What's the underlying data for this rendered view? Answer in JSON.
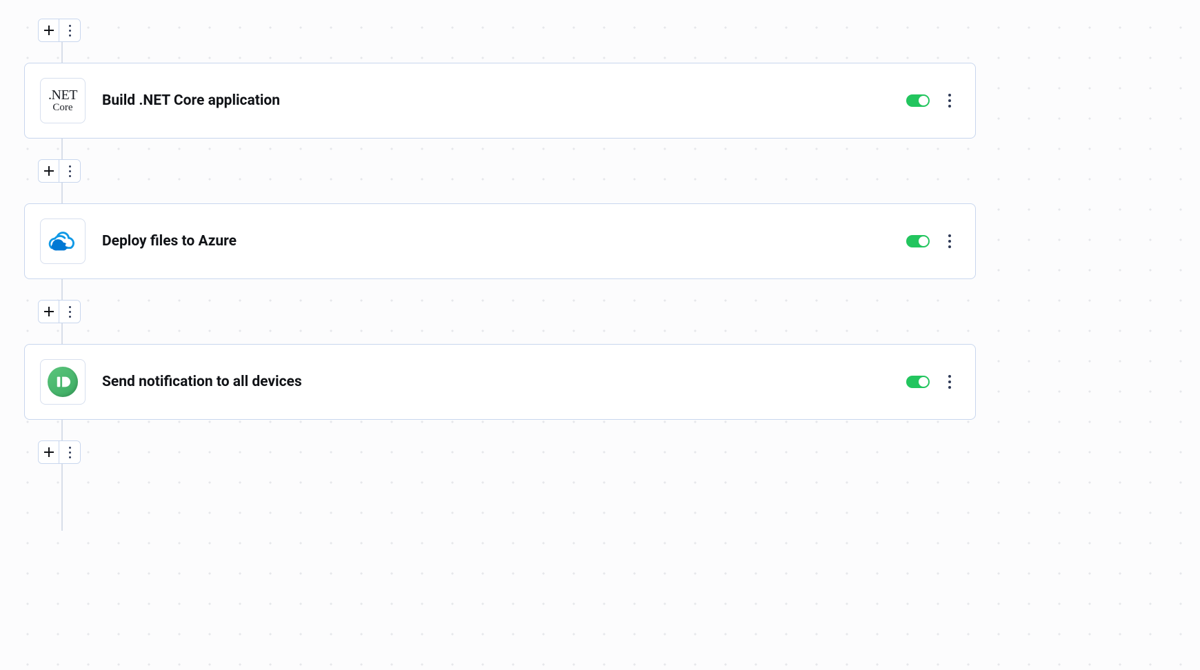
{
  "icons": {
    "dotnet": {
      "line1": ".NET",
      "line2": "Core"
    }
  },
  "colors": {
    "toggle_on": "#22c55e",
    "node_border": "#c8d6ee",
    "azure_blue_dark": "#0078d4",
    "azure_blue_mid": "#1099e6",
    "pushbullet_green": "#45b26b"
  },
  "pipeline": {
    "steps": [
      {
        "id": "build-dotnet",
        "title": "Build .NET Core application",
        "enabled": true,
        "icon": "dotnet-core"
      },
      {
        "id": "deploy-azure",
        "title": "Deploy files to Azure",
        "enabled": true,
        "icon": "azure"
      },
      {
        "id": "send-push",
        "title": "Send notification to all devices",
        "enabled": true,
        "icon": "pushbullet"
      }
    ]
  }
}
